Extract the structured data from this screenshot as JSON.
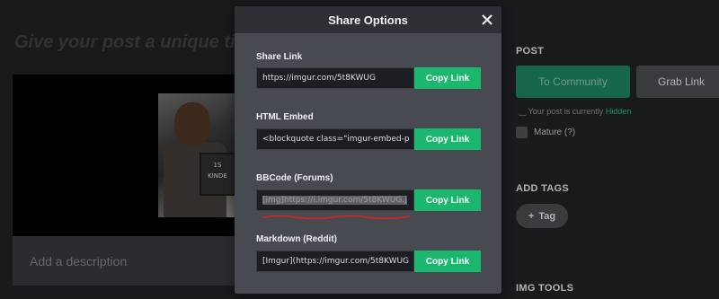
{
  "background": {
    "title_partial": "Give your post a unique tit",
    "description_placeholder": "Add a description",
    "photo_board_lines": [
      "1S",
      "KINDE"
    ],
    "post_heading": "POST",
    "to_community_label": "To Community",
    "grab_link_label": "Grab Link",
    "visibility_text": "Your post is currently",
    "visibility_status": "Hidden",
    "mature_label": "Mature (?)",
    "add_tags_heading": "ADD TAGS",
    "tag_button_label": "Tag",
    "img_tools_heading": "IMG TOOLS"
  },
  "modal": {
    "title": "Share Options",
    "sections": [
      {
        "label": "Share Link",
        "value": "https://imgur.com/5t8KWUG",
        "button": "Copy Link"
      },
      {
        "label": "HTML Embed",
        "value": "<blockquote class=\"imgur-embed-p",
        "button": "Copy Link"
      },
      {
        "label": "BBCode (Forums)",
        "value": "[img]https://i.imgur.com/5t8KWUG.j",
        "button": "Copy Link"
      },
      {
        "label": "Markdown (Reddit)",
        "value": "[Imgur](https://imgur.com/5t8KWUG",
        "button": "Copy Link"
      }
    ]
  },
  "colors": {
    "accent_green": "#1bb76e",
    "annotation_red": "#e02020"
  }
}
